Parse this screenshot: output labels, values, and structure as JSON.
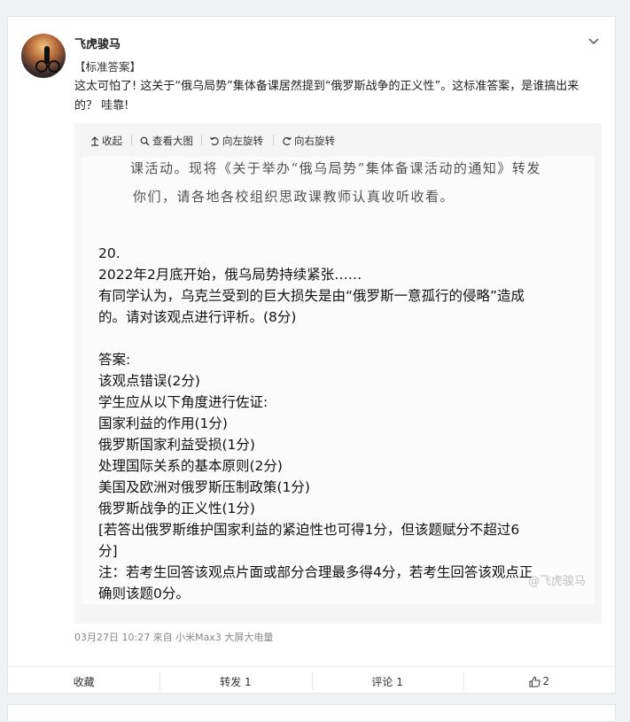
{
  "post": {
    "author": "飞虎骏马",
    "tag": "【标准答案】",
    "text": "这太可怕了! 这关于“俄乌局势”集体备课居然提到“俄罗斯战争的正义性”。这标准答案，是谁搞出来的？ 哇靠!",
    "meta": "03月27日 10:27  来自 小米Max3 大屏大电量"
  },
  "toolbar": {
    "collapse": "收起",
    "view_large": "查看大图",
    "rotate_left": "向左旋转",
    "rotate_right": "向右旋转"
  },
  "image": {
    "scan_lines": [
      "课活动。现将《关于举办“俄乌局势”集体备课活动的通知》转发",
      "你们，请各地各校组织思政课教师认真收听收看。"
    ],
    "lines": [
      "20.",
      "2022年2月底开始，俄乌局势持续紧张……",
      "有同学认为，乌克兰受到的巨大损失是由“俄罗斯一意孤行的侵略”造成",
      "的。请对该观点进行评析。(8分)",
      "",
      "答案:",
      "该观点错误(2分)",
      "学生应从以下角度进行佐证:",
      "国家利益的作用(1分)",
      "俄罗斯国家利益受损(1分)",
      "处理国际关系的基本原则(2分)",
      "美国及欧洲对俄罗斯压制政策(1分)",
      "俄罗斯战争的正义性(1分)",
      "[若答出俄罗斯维护国家利益的紧迫性也可得1分，但该题赋分不超过6",
      "分]",
      "注：若考生回答该观点片面或部分合理最多得4分，若考生回答该观点正",
      "确则该题0分。"
    ],
    "watermark": "@飞虎骏马"
  },
  "footer": {
    "favorite": "收藏",
    "repost": "转发 1",
    "comment": "评论 1",
    "like_count": "2"
  }
}
